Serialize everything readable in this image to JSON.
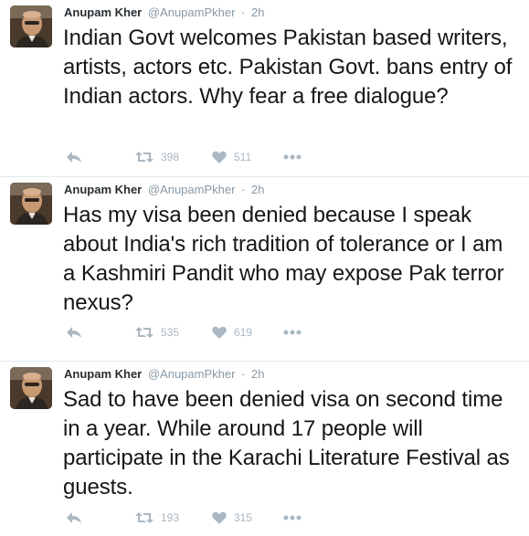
{
  "tweets": [
    {
      "author": {
        "name": "Anupam Kher",
        "handle": "@AnupamPkher"
      },
      "separator": "·",
      "time": "2h",
      "text": "Indian Govt welcomes Pakistan based writers, artists, actors etc. Pakistan Govt. bans entry of Indian actors. Why fear a free dialogue?",
      "retweets": "398",
      "likes": "511"
    },
    {
      "author": {
        "name": "Anupam Kher",
        "handle": "@AnupamPkher"
      },
      "separator": "·",
      "time": "2h",
      "text": "Has my visa been denied because I speak about India's rich tradition of tolerance or I am a Kashmiri Pandit who may expose Pak terror nexus?",
      "retweets": "535",
      "likes": "619"
    },
    {
      "author": {
        "name": "Anupam Kher",
        "handle": "@AnupamPkher"
      },
      "separator": "·",
      "time": "2h",
      "text": "Sad to have been denied visa on second time in a year. While around 17 people will participate in the Karachi Literature Festival as guests.",
      "retweets": "193",
      "likes": "315"
    }
  ],
  "icons": {
    "reply": "reply-icon",
    "retweet": "retweet-icon",
    "like": "heart-icon",
    "more": "more-icon"
  },
  "colors": {
    "icon": "#aab8c2",
    "meta": "#8899a6",
    "divider": "#e1e8ed",
    "text": "#14171a"
  }
}
